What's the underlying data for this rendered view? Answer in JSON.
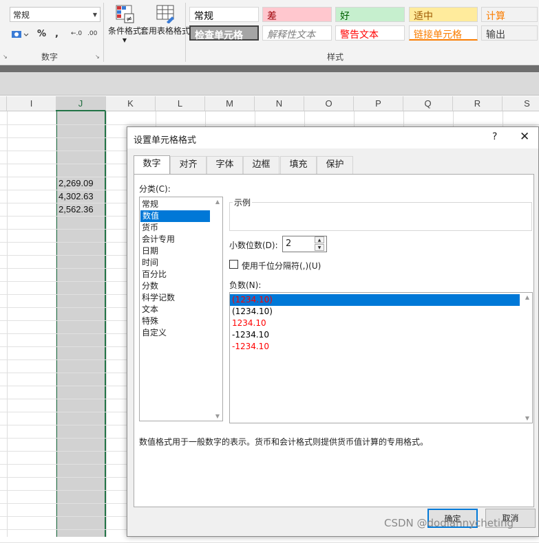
{
  "ribbon": {
    "number_format_value": "常规",
    "percent_symbol": "%",
    "comma_symbol": ",",
    "increase_decimal": "←.0",
    "decrease_decimal": ".00",
    "number_group_label": "数字",
    "conditional_format_label": "条件格式",
    "table_format_label": "套用表格格式",
    "styles_group_label": "样式",
    "cell_styles": [
      {
        "label": "常规",
        "bg": "#ffffff",
        "fg": "#000000"
      },
      {
        "label": "差",
        "bg": "#ffc7ce",
        "fg": "#9c0006"
      },
      {
        "label": "好",
        "bg": "#c6efce",
        "fg": "#006100"
      },
      {
        "label": "适中",
        "bg": "#ffeb9c",
        "fg": "#9c5700"
      },
      {
        "label": "计算",
        "bg": "#f2f2f2",
        "fg": "#fa7d00"
      },
      {
        "label": "检查单元格",
        "bg": "#a5a5a5",
        "fg": "#ffffff"
      },
      {
        "label": "解释性文本",
        "bg": "#ffffff",
        "fg": "#7f7f7f"
      },
      {
        "label": "警告文本",
        "bg": "#ffffff",
        "fg": "#ff0000"
      },
      {
        "label": "链接单元格",
        "bg": "#ffffff",
        "fg": "#fa7d00"
      },
      {
        "label": "输出",
        "bg": "#f2f2f2",
        "fg": "#3f3f3f"
      }
    ]
  },
  "sheet": {
    "columns": [
      "I",
      "J",
      "K",
      "L",
      "M",
      "N",
      "O",
      "P",
      "Q",
      "R",
      "S"
    ],
    "selected_column": "J",
    "cells": [
      "2,269.09",
      "4,302.63",
      "2,562.36"
    ]
  },
  "dialog": {
    "title": "设置单元格格式",
    "help": "?",
    "close": "✕",
    "tabs": [
      "数字",
      "对齐",
      "字体",
      "边框",
      "填充",
      "保护"
    ],
    "active_tab": "数字",
    "category_label": "分类(C):",
    "categories": [
      "常规",
      "数值",
      "货币",
      "会计专用",
      "日期",
      "时间",
      "百分比",
      "分数",
      "科学记数",
      "文本",
      "特殊",
      "自定义"
    ],
    "selected_category": "数值",
    "sample_label": "示例",
    "decimal_label": "小数位数(D):",
    "decimal_value": "2",
    "thousands_label": "使用千位分隔符(,)(U)",
    "thousands_checked": false,
    "negative_label": "负数(N):",
    "negative_formats": [
      {
        "text": "(1234.10)",
        "color": "#ff0000"
      },
      {
        "text": "(1234.10)",
        "color": "#000000"
      },
      {
        "text": "1234.10",
        "color": "#ff0000"
      },
      {
        "text": "-1234.10",
        "color": "#000000"
      },
      {
        "text": "-1234.10",
        "color": "#ff0000"
      }
    ],
    "selected_negative_index": 0,
    "description": "数值格式用于一般数字的表示。货币和会计格式则提供货币值计算的专用格式。",
    "ok_label": "确定",
    "cancel_label": "取消"
  },
  "watermark": "CSDN @dodiannycheting",
  "colors": {
    "accent": "#0078d7",
    "excel_green": "#217346"
  }
}
